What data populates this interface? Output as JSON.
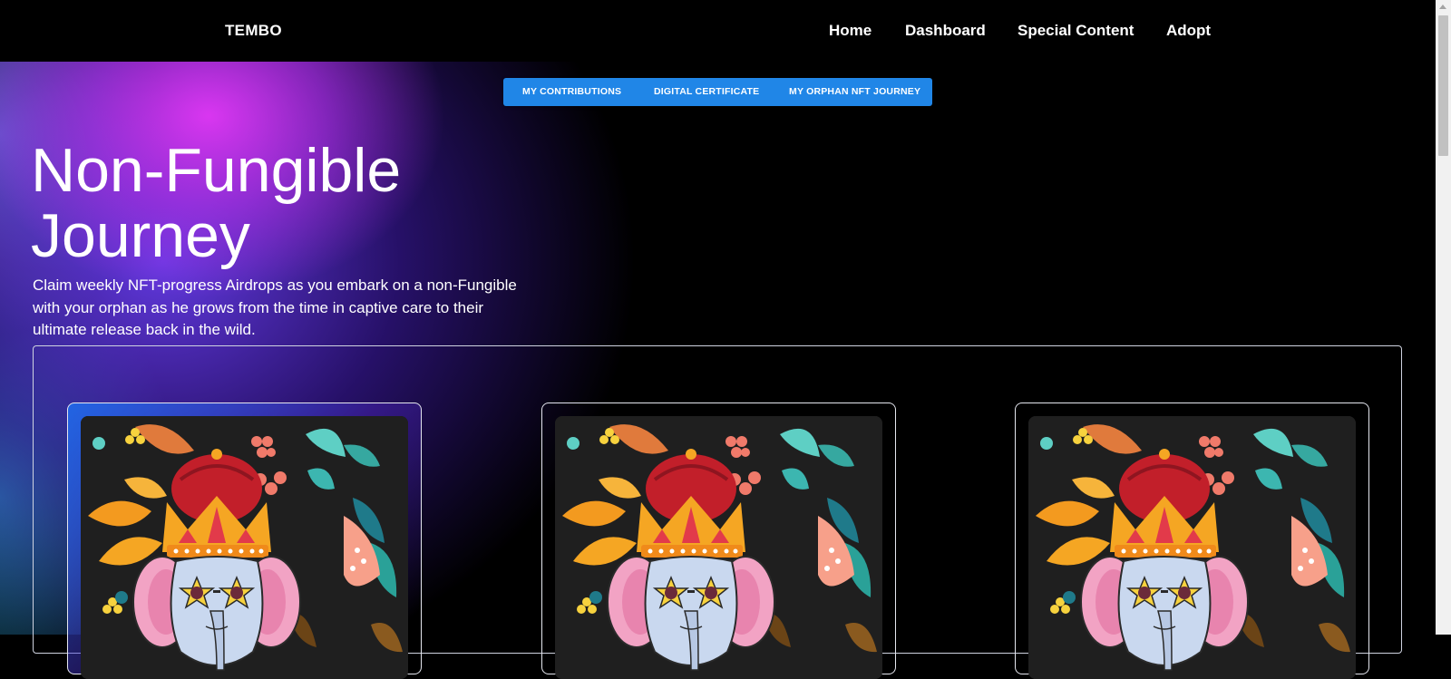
{
  "brand": "TEMBO",
  "nav": {
    "items": [
      "Home",
      "Dashboard",
      "Special Content",
      "Adopt"
    ]
  },
  "subtabs": [
    "MY CONTRIBUTIONS",
    "DIGITAL CERTIFICATE",
    "MY ORPHAN NFT JOURNEY"
  ],
  "hero": {
    "title_line1": "Non-Fungible",
    "title_line2": "Journey",
    "description": "Claim weekly NFT-progress Airdrops as you embark on a non-Fungible with your orphan as he grows from the time in captive care to their ultimate release back in the wild."
  },
  "cards": [
    {
      "art": "crowned-elephant-nft-art",
      "highlighted": true
    },
    {
      "art": "crowned-elephant-nft-art",
      "highlighted": false
    },
    {
      "art": "crowned-elephant-nft-art",
      "highlighted": false
    }
  ],
  "colors": {
    "background": "#000000",
    "subtab_bar": "#2086e7",
    "hero_glow_magenta": "#e238f6",
    "hero_glow_violet": "#673ceb",
    "card_border": "#e5e7ef"
  }
}
